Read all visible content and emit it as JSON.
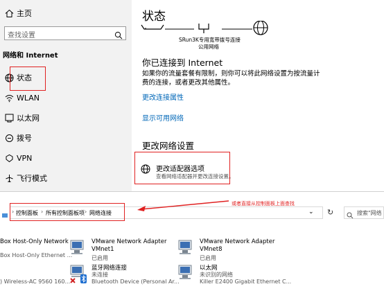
{
  "settings": {
    "home_label": "主页",
    "search_placeholder": "查找设置",
    "section_label": "网络和 Internet",
    "nav": [
      {
        "label": "状态",
        "icon": "globe-icon"
      },
      {
        "label": "WLAN",
        "icon": "wifi-icon"
      },
      {
        "label": "以太网",
        "icon": "ethernet-icon"
      },
      {
        "label": "拨号",
        "icon": "dialup-icon"
      },
      {
        "label": "VPN",
        "icon": "vpn-icon"
      },
      {
        "label": "飞行模式",
        "icon": "airplane-icon"
      }
    ],
    "page_title": "状态",
    "network_caption_line1": "SRun3K专用宽带拨号连接",
    "network_caption_line2": "公用网络",
    "connected_heading": "你已连接到 Internet",
    "connected_desc_line1": "如果你的流量套餐有限制，则你可以将此网络设置为按流量计",
    "connected_desc_line2": "费的连接，或者更改其他属性。",
    "change_props_link": "更改连接属性",
    "show_networks_link": "显示可用网络",
    "change_settings_heading": "更改网络设置",
    "adapter_title": "更改适配器选项",
    "adapter_desc": "查看网络适配器并更改连接设置。"
  },
  "annotation": {
    "text": "或者直接从控制面板上面查找",
    "color": "#e02020"
  },
  "explorer": {
    "breadcrumb": [
      "控制面板",
      "所有控制面板项",
      "网络连接"
    ],
    "search_placeholder": "搜索\"网络",
    "items": [
      {
        "name": "Box Host-Only Network",
        "sub": "Box Host-Only Ethernet ..."
      },
      {
        "name": "VMware Network Adapter VMnet1",
        "sub": "已启用"
      },
      {
        "name": "VMware Network Adapter VMnet8",
        "sub": "已启用"
      },
      {
        "name": "蓝牙网络连接",
        "status": "未连接",
        "sub": "Bluetooth Device (Personal Ar..."
      },
      {
        "name": "以太网",
        "status": "未识别的网络",
        "sub": "Killer E2400 Gigabit Ethernet C..."
      },
      {
        "name": "",
        "sub": ") Wireless-AC 9560 160..."
      }
    ]
  },
  "colors": {
    "accent": "#0067b8",
    "highlight": "#e02020"
  }
}
